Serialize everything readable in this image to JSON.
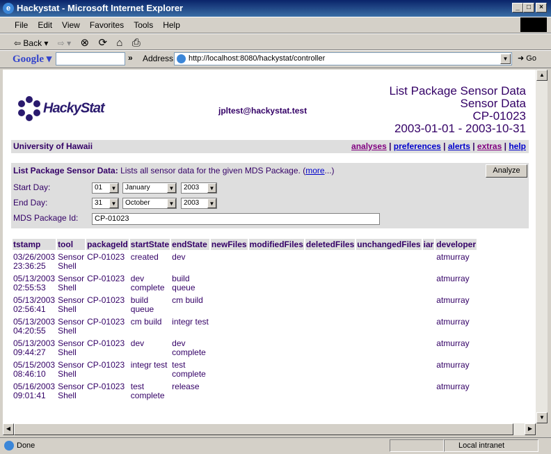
{
  "window": {
    "title": "Hackystat - Microsoft Internet Explorer",
    "min": "_",
    "max": "□",
    "close": "×"
  },
  "menu": [
    "File",
    "Edit",
    "View",
    "Favorites",
    "Tools",
    "Help"
  ],
  "toolbar": {
    "back": "⇦ Back ▾",
    "forward": "⇨ ▾",
    "stop": "⊗",
    "refresh": "⟳",
    "home": "⌂",
    "print": "⎙"
  },
  "google": {
    "logo": "Google ▾",
    "more": "»"
  },
  "address": {
    "label": "Address",
    "url": "http://localhost:8080/hackystat/controller",
    "go": "Go"
  },
  "page": {
    "logo": "HackyStat",
    "user": "jpltest@hackystat.test",
    "title_lines": [
      "List Package Sensor Data",
      "Sensor Data",
      "CP-01023",
      "2003-01-01 - 2003-10-31"
    ],
    "org": "University of Hawaii",
    "nav": [
      {
        "label": "analyses",
        "visited": true
      },
      {
        "label": "preferences",
        "visited": false
      },
      {
        "label": "alerts",
        "visited": false
      },
      {
        "label": "extras",
        "visited": true
      },
      {
        "label": "help",
        "visited": false
      }
    ],
    "form": {
      "heading": "List Package Sensor Data:",
      "description": " Lists all sensor data for the given MDS Package. (",
      "more": "more",
      "more_tail": "...)",
      "analyze": "Analyze",
      "start_label": "Start Day:",
      "start": {
        "day": "01",
        "month": "January",
        "year": "2003"
      },
      "end_label": "End Day:",
      "end": {
        "day": "31",
        "month": "October",
        "year": "2003"
      },
      "pkg_label": "MDS Package Id:",
      "pkg_value": "CP-01023"
    },
    "table": {
      "columns": [
        "tstamp",
        "tool",
        "packageId",
        "startState",
        "endState",
        "newFiles",
        "modifiedFiles",
        "deletedFiles",
        "unchangedFiles",
        "iar",
        "developer"
      ],
      "rows": [
        [
          "03/26/2003\n23:36:25",
          "Sensor\nShell",
          "CP-01023",
          "created",
          "dev",
          "",
          "",
          "",
          "",
          "",
          "atmurray"
        ],
        [
          "05/13/2003\n02:55:53",
          "Sensor\nShell",
          "CP-01023",
          "dev\ncomplete",
          "build\nqueue",
          "",
          "",
          "",
          "",
          "",
          "atmurray"
        ],
        [
          "05/13/2003\n02:56:41",
          "Sensor\nShell",
          "CP-01023",
          "build\nqueue",
          "cm build",
          "",
          "",
          "",
          "",
          "",
          "atmurray"
        ],
        [
          "05/13/2003\n04:20:55",
          "Sensor\nShell",
          "CP-01023",
          "cm build",
          "integr test",
          "",
          "",
          "",
          "",
          "",
          "atmurray"
        ],
        [
          "05/13/2003\n09:44:27",
          "Sensor\nShell",
          "CP-01023",
          "dev",
          "dev\ncomplete",
          "",
          "",
          "",
          "",
          "",
          "atmurray"
        ],
        [
          "05/15/2003\n08:46:10",
          "Sensor\nShell",
          "CP-01023",
          "integr test",
          "test\ncomplete",
          "",
          "",
          "",
          "",
          "",
          "atmurray"
        ],
        [
          "05/16/2003\n09:01:41",
          "Sensor\nShell",
          "CP-01023",
          "test\ncomplete",
          "release",
          "",
          "",
          "",
          "",
          "",
          "atmurray"
        ]
      ]
    }
  },
  "status": {
    "text": "Done",
    "zone": "Local intranet"
  }
}
